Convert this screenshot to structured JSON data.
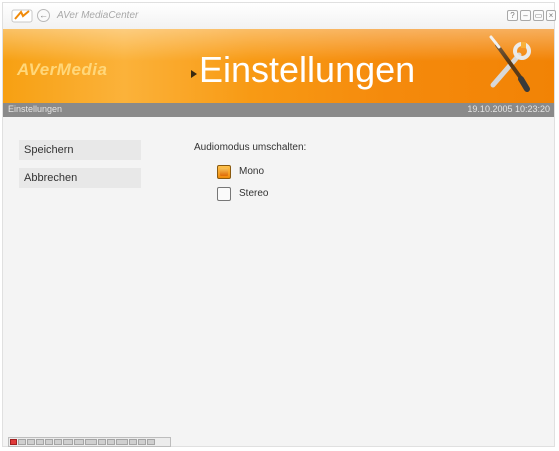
{
  "window": {
    "app_title": "AVer MediaCenter",
    "brand": "AVerMedia",
    "page_title": "Einstellungen",
    "icons": [
      "app-logo-icon",
      "back-icon",
      "help-icon",
      "minimize-icon",
      "restore-icon",
      "close-icon",
      "tools-icon"
    ],
    "back_glyph": "←",
    "help_glyph": "?",
    "minimize_glyph": "–",
    "restore_glyph": "▭",
    "close_glyph": "×"
  },
  "statusbar": {
    "crumb": "Einstellungen",
    "datetime": "19.10.2005 10:23:20"
  },
  "menu": {
    "save_label": "Speichern",
    "cancel_label": "Abbrechen"
  },
  "audio": {
    "section_label": "Audiomodus umschalten:",
    "options": [
      {
        "label": "Mono",
        "checked": true
      },
      {
        "label": "Stereo",
        "checked": false
      }
    ]
  },
  "colors": {
    "header_orange": "#f28305",
    "statusbar_gray": "#8a8a8a",
    "accent_orange": "#f08a0a"
  }
}
